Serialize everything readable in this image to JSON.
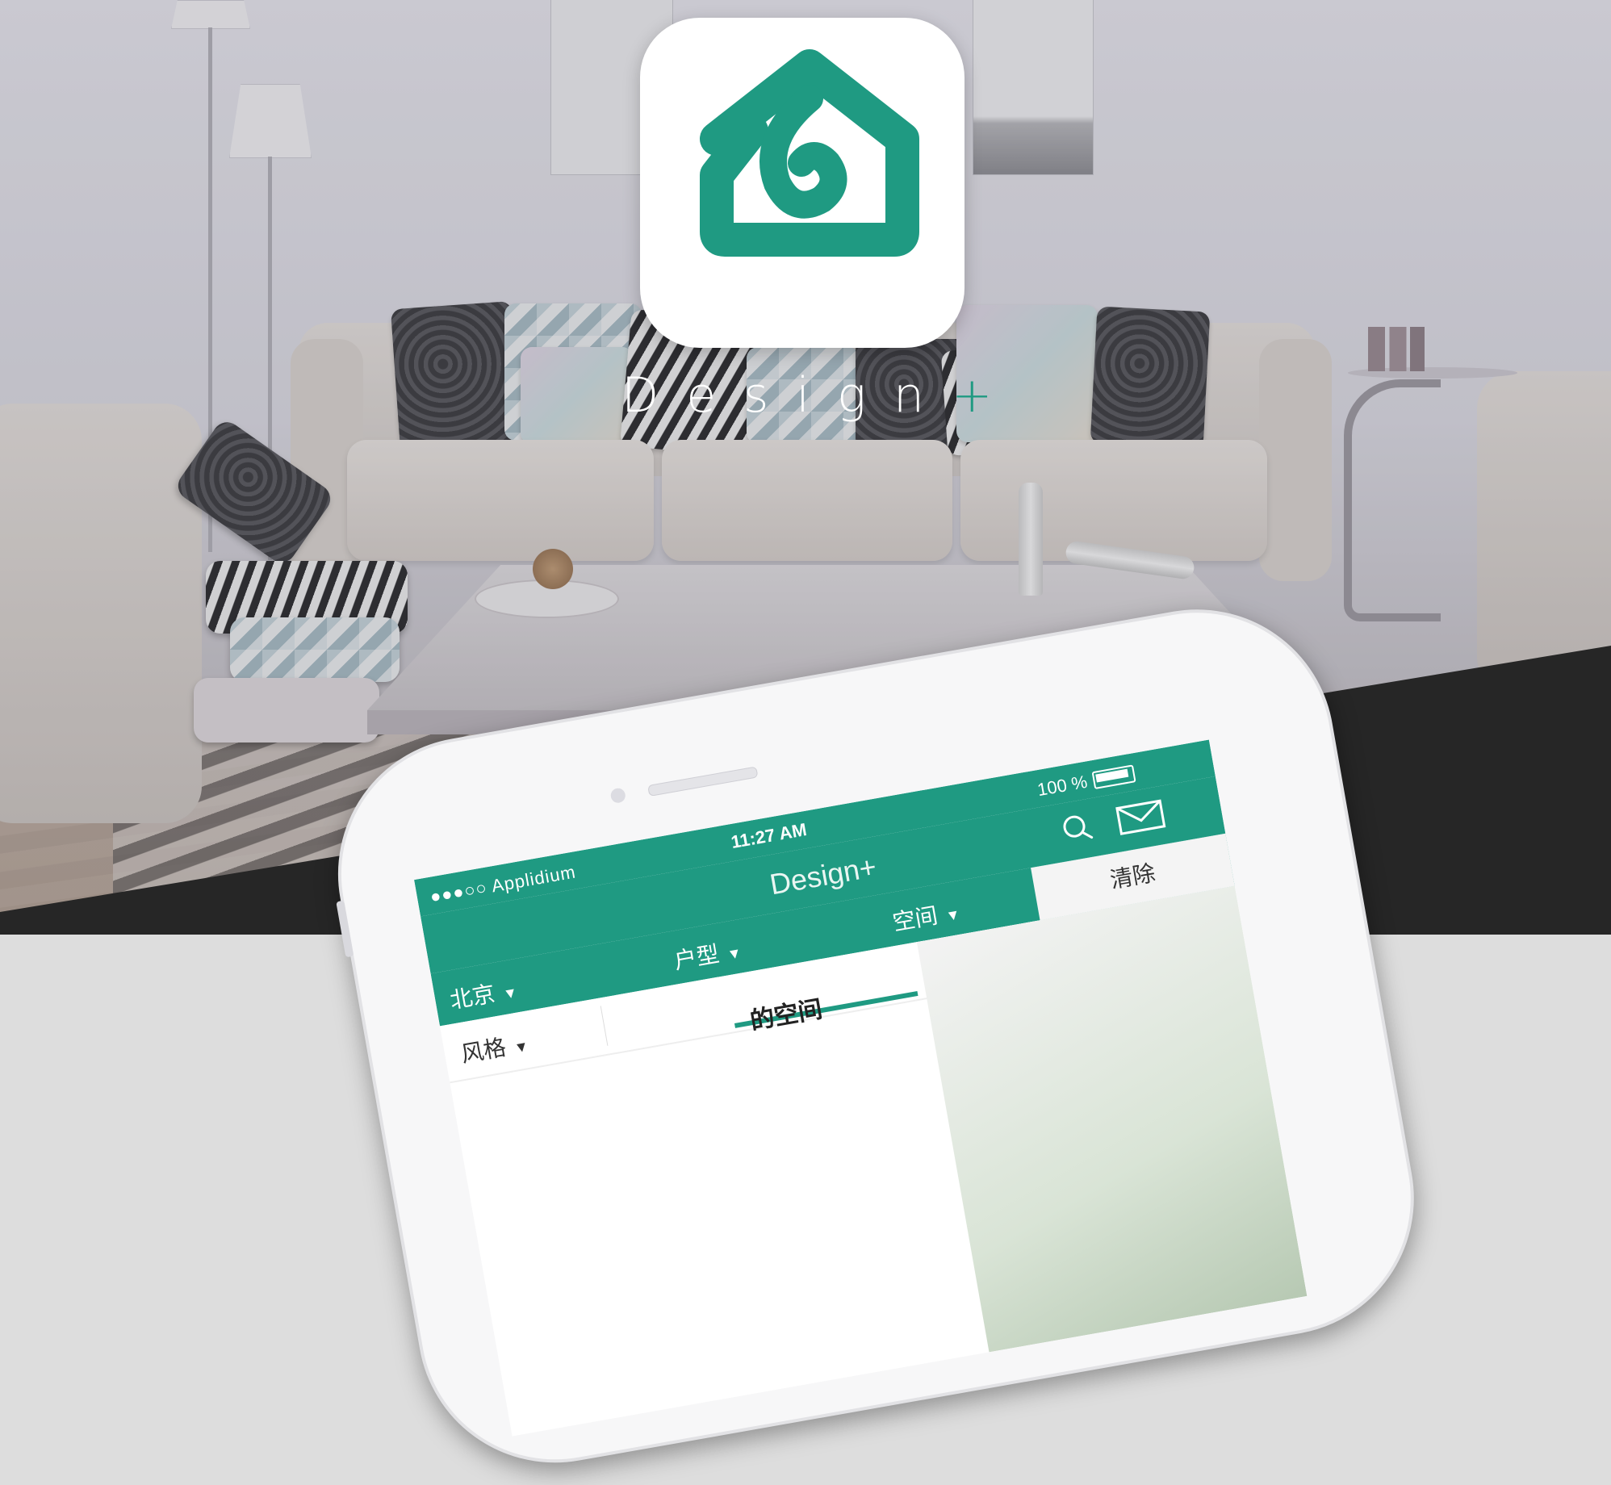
{
  "brand": {
    "wordmark": "Design",
    "wordmark_plus": "+",
    "accent_color": "#1f9a82"
  },
  "phone": {
    "status": {
      "carrier": "●●●○○ Applidium",
      "time": "11:27 AM",
      "battery": "100 %"
    },
    "navbar": {
      "title": "Design+",
      "search_icon": "search-icon",
      "mail_icon": "mail-icon"
    },
    "filters": {
      "city": "北京",
      "layout": "户型",
      "space": "空间",
      "clear": "清除"
    },
    "tabs": {
      "style": "风格"
    },
    "content": {
      "partial_heading": "的空间"
    }
  }
}
